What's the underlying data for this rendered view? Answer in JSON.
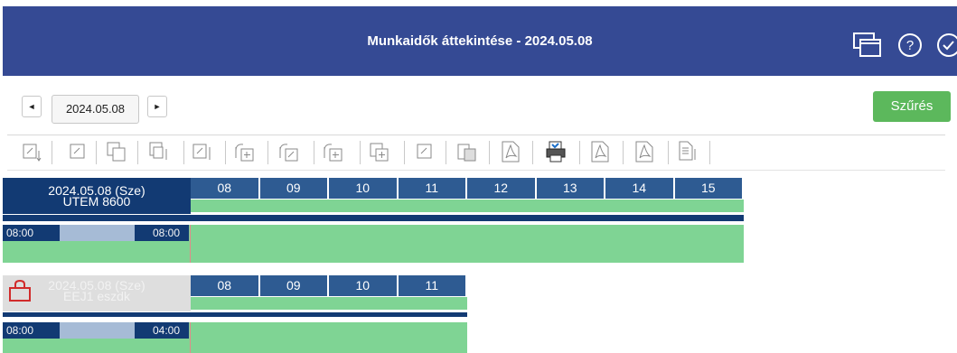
{
  "header": {
    "title": "Munkaidők áttekintése - 2024.05.08",
    "icons": [
      "windows-icon",
      "help-icon",
      "check-icon"
    ]
  },
  "nav": {
    "prev_icon": "◄",
    "next_icon": "►",
    "date": "2024.05.08",
    "filter_label": "Szűrés"
  },
  "toolbar": {
    "tools": [
      "edit-down-tool",
      "edit-tool",
      "copy-tool",
      "copy-edit-tool",
      "edit-pencil-tool",
      "add-forward-tool",
      "swap-tool",
      "swap-add-tool",
      "add-tool",
      "edit-small-tool",
      "clipboard-tool",
      "pdf-tool",
      "print-tool",
      "pdf2-tool",
      "pdf3-tool",
      "document-tool"
    ]
  },
  "schedules": [
    {
      "date": "2024.05.08 (Sze)",
      "name": "UTEM 8600",
      "hours": [
        "08",
        "09",
        "10",
        "11",
        "12",
        "13",
        "14",
        "15"
      ],
      "start": "08:00",
      "duration": "08:00",
      "locked": false
    },
    {
      "date": "2024.05.08 (Sze)",
      "name": "EEJ1 eszdk",
      "hours": [
        "08",
        "09",
        "10",
        "11"
      ],
      "start": "08:00",
      "duration": "04:00",
      "locked": true
    }
  ],
  "colors": {
    "header_bg": "#354a94",
    "hour_bg": "#2e5b92",
    "green": "#7fd494",
    "dark_blue": "#123a73",
    "filter_btn": "#5cb85c",
    "lock_red": "#d12b2b"
  }
}
